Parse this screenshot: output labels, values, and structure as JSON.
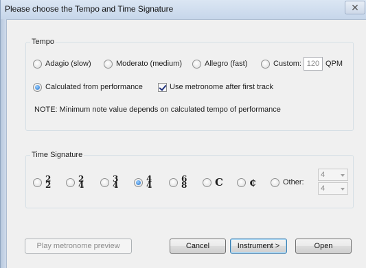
{
  "window": {
    "title": "Please choose the Tempo and Time Signature",
    "close_glyph": "✕"
  },
  "tempo": {
    "legend": "Tempo",
    "options": [
      {
        "label": "Adagio (slow)",
        "selected": false
      },
      {
        "label": "Moderato (medium)",
        "selected": false
      },
      {
        "label": "Allegro (fast)",
        "selected": false
      },
      {
        "label": "Custom:",
        "selected": false
      }
    ],
    "custom_value": "120",
    "custom_unit": "QPM",
    "calculated_label": "Calculated from performance",
    "calculated_selected": true,
    "metronome_label": "Use metronome after first track",
    "metronome_checked": true,
    "note": "NOTE: Minimum note value depends on calculated tempo of performance"
  },
  "time_signature": {
    "legend": "Time Signature",
    "options": [
      {
        "top": "2",
        "bottom": "2",
        "selected": false
      },
      {
        "top": "2",
        "bottom": "4",
        "selected": false
      },
      {
        "top": "3",
        "bottom": "4",
        "selected": false
      },
      {
        "top": "4",
        "bottom": "4",
        "selected": true
      },
      {
        "top": "6",
        "bottom": "8",
        "selected": false
      }
    ],
    "common_time_symbol": "C",
    "cut_time_symbol": "¢",
    "other_label": "Other:",
    "other_numerator": "4",
    "other_denominator": "4"
  },
  "buttons": {
    "preview": "Play metronome preview",
    "cancel": "Cancel",
    "instrument": "Instrument >",
    "open": "Open"
  }
}
